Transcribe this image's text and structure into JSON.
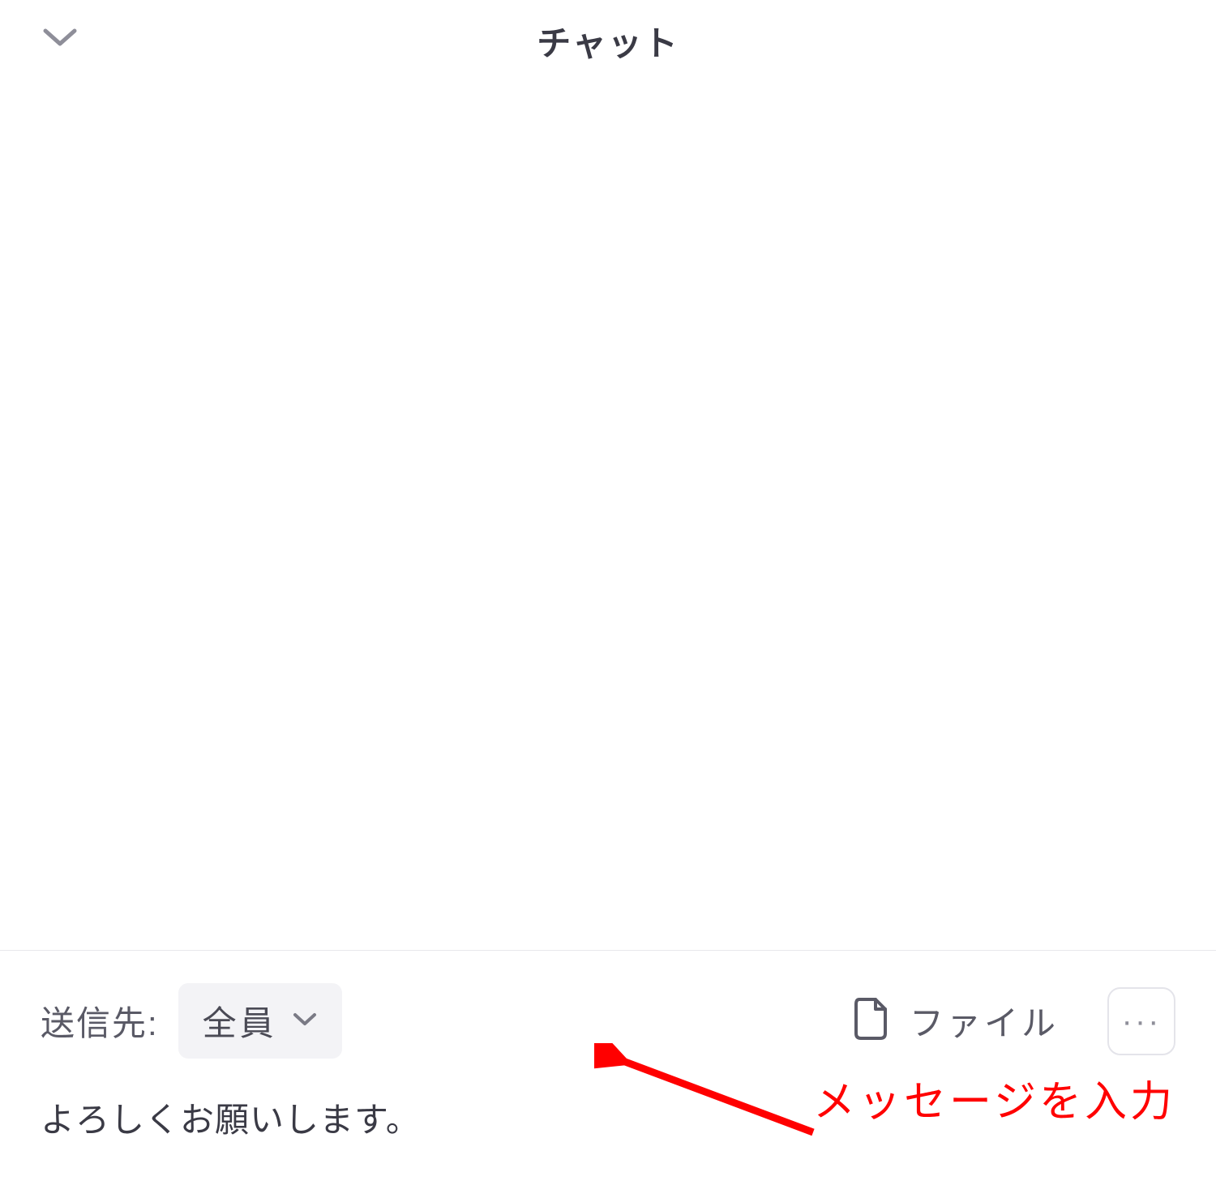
{
  "header": {
    "title": "チャット"
  },
  "input_area": {
    "send_to_label": "送信先:",
    "recipient_selected": "全員",
    "file_button_label": "ファイル",
    "message_value": "よろしくお願いします。"
  },
  "annotation": {
    "text": "メッセージを入力"
  }
}
